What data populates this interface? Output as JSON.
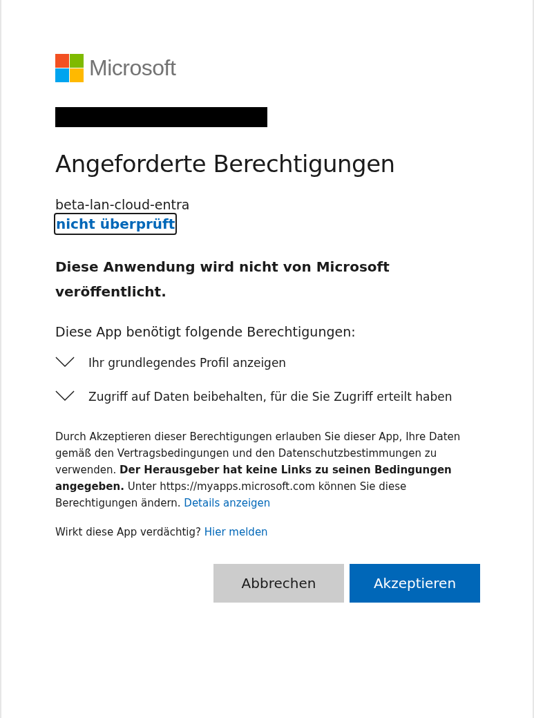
{
  "logo": {
    "name": "Microsoft"
  },
  "account": {
    "redacted": true
  },
  "title": "Angeforderte Berechtigungen",
  "app": {
    "name": "beta-lan-cloud-entra",
    "verification_link": "nicht überprüft",
    "focused": true
  },
  "publisher_notice": "Diese Anwendung wird nicht von Microsoft veröffentlicht.",
  "permissions_heading": "Diese App benötigt folgende Berechtigungen:",
  "permissions": [
    {
      "label": "Ihr grundlegendes Profil anzeigen",
      "expanded": false
    },
    {
      "label": "Zugriff auf Daten beibehalten, für die Sie Zugriff erteilt haben",
      "expanded": false
    }
  ],
  "consent": {
    "text": "Durch Akzeptieren dieser Berechtigungen erlauben Sie dieser App, Ihre Daten gemäß den Vertragsbedingungen und den Datenschutzbestimmungen zu verwenden. **Der Herausgeber hat keine Links zu seinen Bedingungen angegeben.** Unter https://myapps.microsoft.com können Sie diese Berechtigungen ändern.",
    "link": "Details anzeigen"
  },
  "report": {
    "text": "Wirkt diese App verdächtig?",
    "link": "Hier melden"
  },
  "buttons": [
    {
      "label": "Abbrechen",
      "kind": "secondary"
    },
    {
      "label": "Akzeptieren",
      "kind": "primary"
    }
  ]
}
